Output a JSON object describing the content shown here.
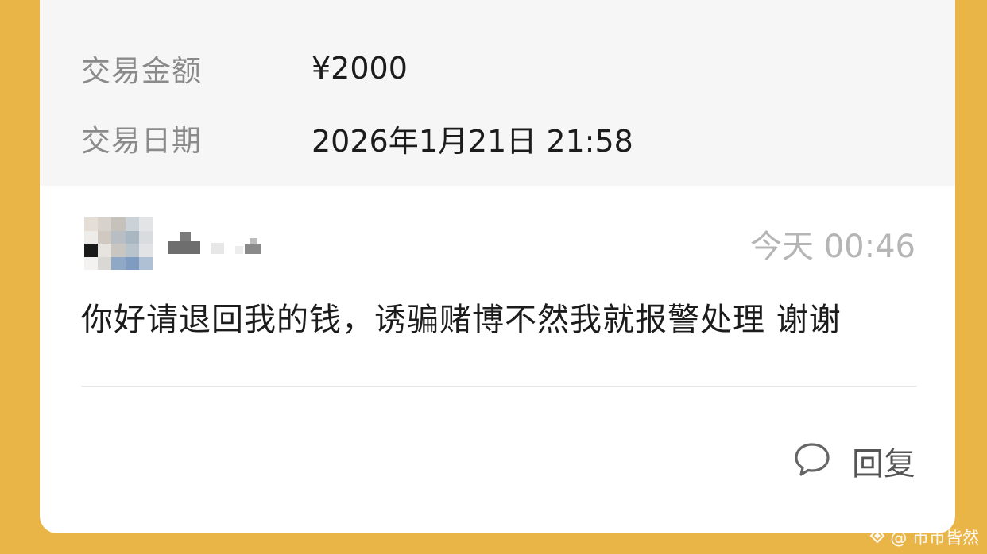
{
  "transaction": {
    "amount_label": "交易金额",
    "amount_value": "¥2000",
    "date_label": "交易日期",
    "date_value": "2026年1月21日 21:58"
  },
  "message": {
    "avatar_icon": "avatar-icon",
    "timestamp": "今天 00:46",
    "text": "你好请退回我的钱，诱骗赌博不然我就报警处理 谢谢"
  },
  "actions": {
    "reply_icon": "comment-bubble-icon",
    "reply_label": "回复"
  },
  "watermark": {
    "text": "@ 币币皆然"
  },
  "colors": {
    "background": "#E9B547",
    "card": "#FFFFFF",
    "details_bg": "#F6F6F6",
    "label_text": "#8A8A8A",
    "primary_text": "#1C1C1C",
    "muted_text": "#B5B5B5"
  }
}
